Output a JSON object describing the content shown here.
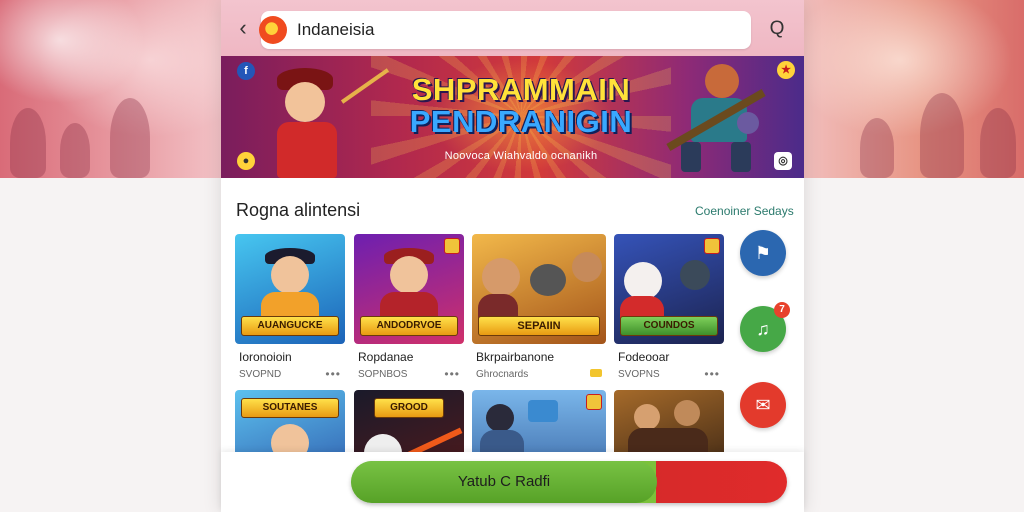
{
  "search": {
    "back_icon": "chevron-left-icon",
    "value": "Indaneisia",
    "search_icon": "magnifier-icon"
  },
  "banner": {
    "title_line1": "SHPRAMMAIN",
    "title_line2": "PENDRANIGIN",
    "subtitle": "Noovoca Wiahvaldo ocnanikh"
  },
  "section": {
    "title": "Rogna alintensi",
    "link": "Coenoiner Sedays"
  },
  "games": [
    {
      "name": "Ioronoioin",
      "meta": "SVOPND",
      "accent": "#2a8fd4",
      "logo": "AUANGUCKE",
      "action": "more"
    },
    {
      "name": "Ropdanae",
      "meta": "SOPNBOS",
      "accent": "#8a2bb3",
      "logo": "ANDODRVOE",
      "action": "more"
    },
    {
      "name": "Bkrpairbanone",
      "meta": "Ghrocnards",
      "accent": "#e39a2a",
      "logo": "SEPAIIN",
      "action": "tag"
    },
    {
      "name": "Fodeooar",
      "meta": "SVOPNS",
      "accent": "#2f3f9a",
      "logo": "COUNDOS",
      "action": "more"
    },
    {
      "name": "",
      "meta": "",
      "accent": "#3b7ad6",
      "logo": "SOUTANES"
    },
    {
      "name": "",
      "meta": "",
      "accent": "#1e1e2e",
      "logo": "GROOD"
    },
    {
      "name": "",
      "meta": "",
      "accent": "#4a86c8",
      "logo": ""
    },
    {
      "name": "",
      "meta": "",
      "accent": "#6b4a2a",
      "logo": ""
    }
  ],
  "side_buttons": [
    {
      "icon": "chat-flag-icon",
      "color": "#2b67b0"
    },
    {
      "icon": "megaphone-icon",
      "color": "#46a847",
      "count": "7"
    },
    {
      "icon": "speech-bubble-icon",
      "color": "#e33a2c"
    }
  ],
  "cta": {
    "label": "Yatub C Radfi"
  }
}
